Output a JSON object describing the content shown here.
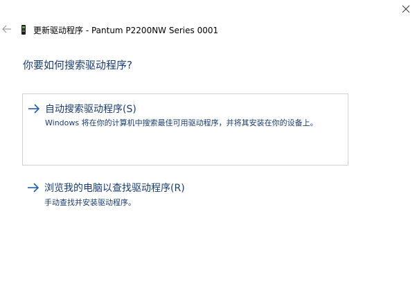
{
  "window": {
    "title": "更新驱动程序 - Pantum P2200NW Series 0001"
  },
  "icons": {
    "close": "close-icon",
    "back": "back-arrow-icon",
    "device": "printer-device-icon",
    "option_arrow": "right-arrow-icon"
  },
  "colors": {
    "link_blue": "#1a3c6e",
    "arrow_blue": "#1f5fa8",
    "border": "#d0d0d0"
  },
  "main": {
    "heading": "你要如何搜索驱动程序?",
    "options": [
      {
        "title": "自动搜索驱动程序(S)",
        "description": "Windows 将在你的计算机中搜索最佳可用驱动程序，并将其安装在你的设备上。"
      },
      {
        "title": "浏览我的电脑以查找驱动程序(R)",
        "description": "手动查找并安装驱动程序。"
      }
    ]
  }
}
